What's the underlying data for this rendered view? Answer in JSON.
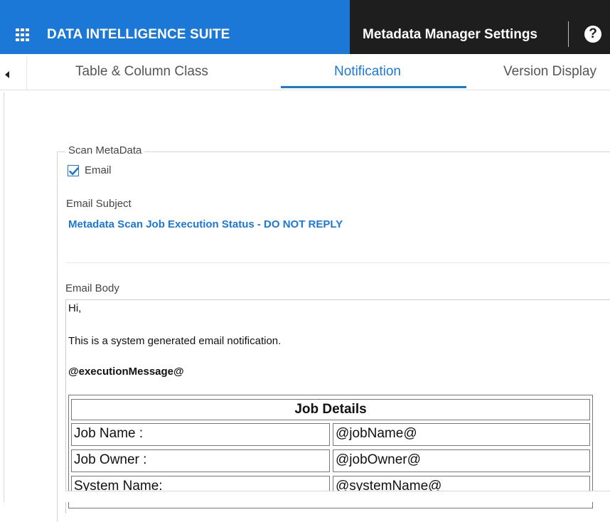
{
  "header": {
    "brand_title": "DATA INTELLIGENCE SUITE",
    "settings_title": "Metadata Manager Settings",
    "help_glyph": "?",
    "brand_color": "#1c78d6",
    "dark_color": "#1e1e1e"
  },
  "tabs": [
    {
      "label": "Table & Column Class",
      "active": false
    },
    {
      "label": "Notification",
      "active": true
    },
    {
      "label": "Version Display",
      "active": false
    }
  ],
  "section": {
    "legend": "Scan MetaData",
    "email_checkbox_label": "Email",
    "email_checked": true,
    "subject_label": "Email Subject",
    "subject_value": "Metadata Scan Job Execution Status - DO NOT REPLY",
    "body_label": "Email Body"
  },
  "email_body": {
    "greeting": "Hi,",
    "intro": "This is a system generated email notification.",
    "message_token": "@executionMessage@",
    "table_title": "Job Details",
    "rows": [
      {
        "label": "Job Name :",
        "value": "@jobName@"
      },
      {
        "label": "Job Owner :",
        "value": "@jobOwner@"
      },
      {
        "label": "System Name:",
        "value": "@systemName@"
      }
    ]
  }
}
